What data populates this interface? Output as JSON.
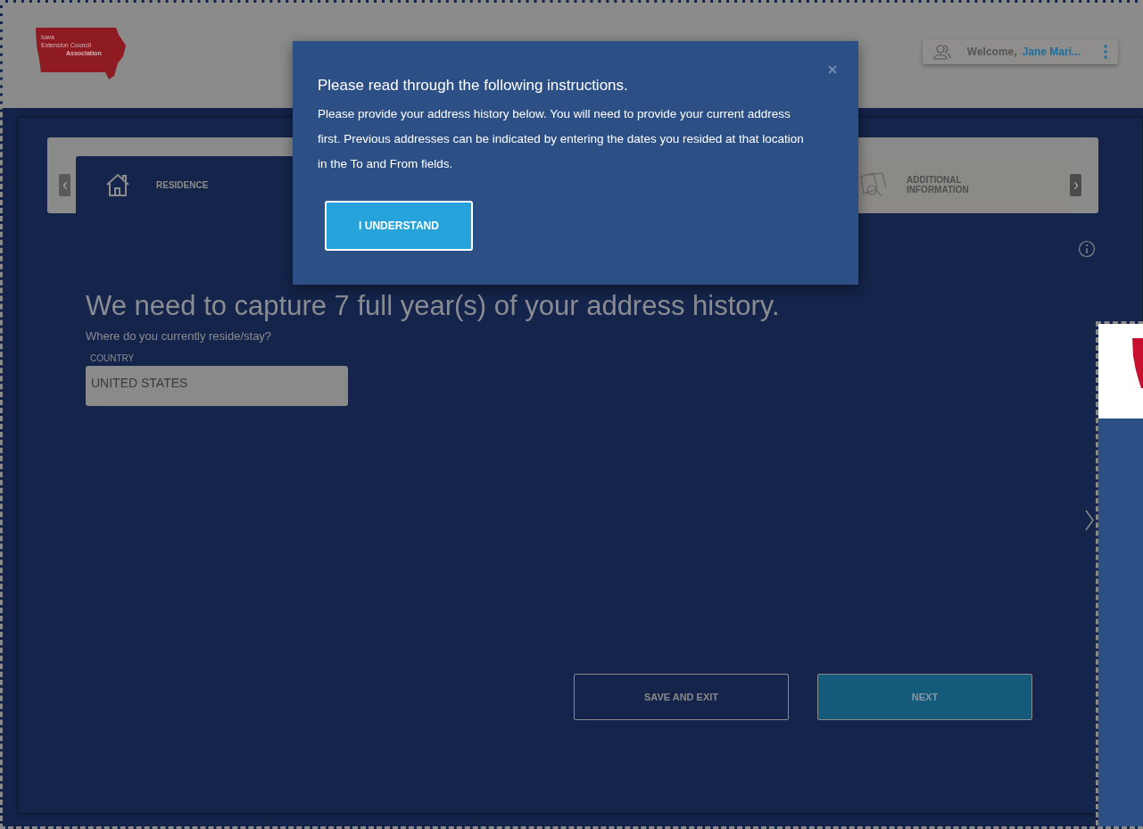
{
  "header": {
    "logo": {
      "lines": [
        "Iowa",
        "Extension Council",
        "Association"
      ]
    },
    "user_menu": {
      "greeting": "Welcome,",
      "name": "Jane Mari..."
    }
  },
  "stepper": {
    "steps": [
      {
        "label": "RESIDENCE",
        "selected": true,
        "kind": "residence"
      },
      {
        "label": "ADDITIONAL INFORMATION",
        "selected": false,
        "kind": "additional"
      }
    ]
  },
  "form": {
    "heading": "We need to capture 7 full year(s) of your address history.",
    "question": "Where do you currently reside/stay?",
    "country": {
      "label": "COUNTRY",
      "value": "UNITED STATES"
    }
  },
  "buttons": [
    {
      "label": "SAVE AND EXIT",
      "kind": "secondary"
    },
    {
      "label": "NEXT",
      "kind": "primary"
    }
  ],
  "modal": {
    "title": "Please read through the following instructions.",
    "body": "Please provide your address history below. You will need to provide your current address first. Previous addresses can be indicated by entering the dates you resided at that location in the To and From fields.",
    "button": "I UNDERSTAND"
  }
}
